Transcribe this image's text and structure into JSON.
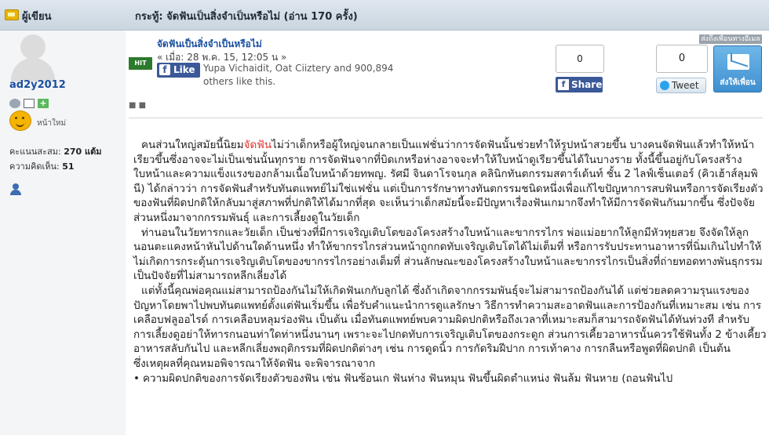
{
  "header": {
    "author_label": "ผู้เขียน",
    "thread_title": "กระทู้: จัดฟันเป็นสิ่งจำเป็นหรือไม่ (อ่าน 170 ครั้ง)"
  },
  "user": {
    "name": "ad2y2012",
    "rank": "หน้าใหม่",
    "score_label": "คะแนนสะสม:",
    "score_value": "270 แต้ม",
    "opinion_label": "ความคิดเห็น:",
    "opinion_value": "51"
  },
  "post": {
    "title": "จัดฟันเป็นสิ่งจำเป็นหรือไม่",
    "date": "« เมื่อ: 28 พ.ค. 15, 12:05 น »",
    "hit_badge": "HIT",
    "like_label": "Like",
    "like_text": "Yupa Vichaidit, Oat Ciiztery and 900,894 others like this.",
    "dots": "■ ■"
  },
  "social": {
    "fb_count": "0",
    "share_label": "Share",
    "tweet_count": "0",
    "tweet_label": "Tweet",
    "send_top": "ส่งถึงเพื่อนทางอีเมล",
    "send_label": "ส่งให้เพื่อน"
  },
  "content": {
    "p1_before": "คนส่วนใหญ่สมัยนี้นิยม",
    "p1_link": "จัดฟัน",
    "p1_after": "ไม่ว่าเด็กหรือผู้ใหญ่จนกลายเป็นแฟชั่นว่าการจัดฟันนั้นช่วยทำให้รูปหน้าสวยขึ้น บางคนจัดฟันแล้วทำให้หน้าเรียวขึ้นซึ่งอาจจะไม่เป็นเช่นนั้นทุกราย การจัดฟันจากที่บิดเกหรือห่างอาจจะทำให้ใบหน้าดูเรียวขึ้นได้ในบางราย ทั้งนี้ขึ้นอยู่กับโครงสร้างใบหน้าและความแข็งแรงของกล้ามเนื้อใบหน้าด้วยทพญ. รัศมี จินดาโรจนกุล คลินิกทันตกรรมสตาร์เด้นท์ ชั้น 2 ไลฟ์เซ็นเตอร์ (คิวเฮ้าส์ลุมพินี) ได้กล่าวว่า การจัดฟันสำหรับทันตแพทย์ไม่ใช่แฟชั่น แต่เป็นการรักษาทางทันตกรรมชนิดหนึ่งเพื่อแก้ไขปัญหาการสบฟันหรือการจัดเรียงตัวของฟันที่ผิดปกติให้กลับมาสู่สภาพที่ปกติให้ได้มากที่สุด จะเห็นว่าเด็กสมัยนี้จะมีปัญหาเรื่องฟันเกมากจึงทำให้มีการจัดฟันกันมากขึ้น ซึ่งปัจจัยส่วนหนึ่งมาจากกรรมพันธุ์ และการเลี้ยงดูในวัยเด็ก",
    "p2": "ท่านอนในวัยทารกและวัยเด็ก เป็นช่วงที่มีการเจริญเติบโตของโครงสร้างใบหน้าและขากรรไกร พ่อแม่อยากให้ลูกมีหัวทุยสวย จึงจัดให้ลูกนอนตะแคงหน้าหันไปด้านใดด้านหนึ่ง ทำให้ขากรรไกรส่วนหน้าถูกกดทับเจริญเติบโตได้ไม่เต็มที่ หรือการรับประทานอาหารที่นิ่มเกินไปทำให้ไม่เกิดการกระตุ้นการเจริญเติบโตของขากรรไกรอย่างเต็มที่ ส่วนลักษณะของโครงสร้างใบหน้าและขากรรไกรเป็นสิ่งที่ถ่ายทอดทางพันธุกรรมเป็นปัจจัยที่ไม่สามารถหลีกเลี่ยงได้",
    "p3": "แต่ทั้งนี้คุณพ่อคุณแม่สามารถป้องกันไม่ให้เกิดฟันเกกับลูกได้ ซึ่งถ้าเกิดจากกรรมพันธุ์จะไม่สามารถป้องกันได้ แต่ช่วยลดความรุนแรงของปัญหาโดยพาไปพบทันตแพทย์ตั้งแต่ฟันเริ่มขึ้น เพื่อรับคำแนะนำการดูแลรักษา วิธีการทำความสะอาดฟันและการป้องกันที่เหมาะสม เช่น การเคลือบฟลูออไรด์ การเคลือบหลุมร่องฟัน เป็นต้น เมื่อทันตแพทย์พบความผิดปกติหรือถึงเวลาที่เหมาะสมก็สามารถจัดฟันได้ทันท่วงที สำหรับการเลี้ยงดูอย่าให้ทารกนอนท่าใดท่าหนึ่งนานๆ เพราะจะไปกดทับการเจริญเติบโตของกระดูก ส่วนการเคี้ยวอาหารนั้นควรใช้ฟันทั้ง 2 ข้างเคี้ยวอาหารสลับกันไป และหลีกเลี่ยงพฤติกรรมที่ผิดปกติต่างๆ เช่น การดูดนิ้ว การกัดริมฝีปาก การเท้าคาง การกลืนหรือพูดที่ผิดปกติ เป็นต้น",
    "p4": "ซึ่งเหตุผลที่คุณหมอพิจารณาให้จัดฟัน จะพิจารณาจาก",
    "bullet1": "ความผิดปกติของการจัดเรียงตัวของฟัน เช่น ฟันซ้อนเก ฟันห่าง ฟันหมุน ฟันขึ้นผิดตำแหน่ง ฟันล้ม ฟันหาย (ถอนฟันไป"
  }
}
